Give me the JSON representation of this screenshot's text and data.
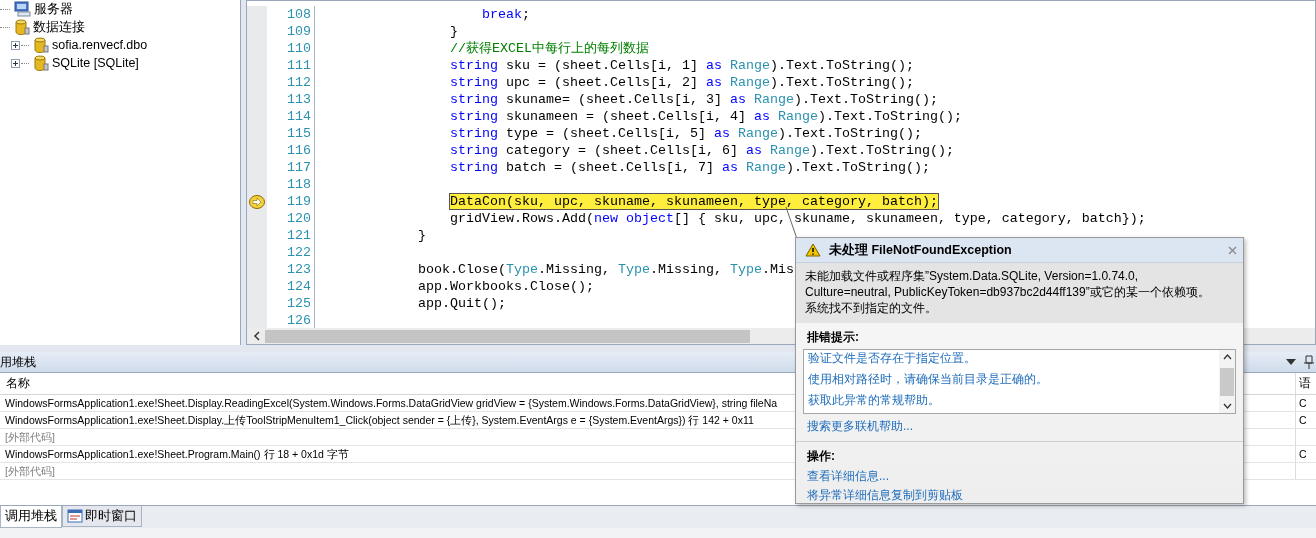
{
  "server_explorer": {
    "items": [
      {
        "label": "服务器",
        "kind": "server"
      },
      {
        "label": "数据连接",
        "kind": "database",
        "children": [
          {
            "label": "sofia.renvecf.dbo",
            "kind": "database",
            "expanded": false
          },
          {
            "label": "SQLite [SQLite]",
            "kind": "database",
            "expanded": false
          }
        ]
      }
    ]
  },
  "editor": {
    "lines": [
      {
        "no": "108",
        "tokens": [
          {
            "t": "                    break",
            "kind": "kw"
          },
          {
            "t": ";",
            "kind": "plain"
          }
        ]
      },
      {
        "no": "109",
        "tokens": [
          {
            "t": "                }",
            "kind": "plain"
          }
        ]
      },
      {
        "no": "110",
        "tokens": [
          {
            "t": "                //获得EXCEL中每行上的每列数据",
            "kind": "comment"
          }
        ]
      },
      {
        "no": "111",
        "tokens": [
          {
            "t": "                string",
            "kind": "kw"
          },
          {
            "t": " sku = (sheet.Cells[i, 1] ",
            "kind": "plain"
          },
          {
            "t": "as",
            "kind": "kw"
          },
          {
            "t": " Range",
            "kind": "type"
          },
          {
            "t": ").Text.ToString();",
            "kind": "plain"
          }
        ]
      },
      {
        "no": "112",
        "tokens": [
          {
            "t": "                string",
            "kind": "kw"
          },
          {
            "t": " upc = (sheet.Cells[i, 2] ",
            "kind": "plain"
          },
          {
            "t": "as",
            "kind": "kw"
          },
          {
            "t": " Range",
            "kind": "type"
          },
          {
            "t": ").Text.ToString();",
            "kind": "plain"
          }
        ]
      },
      {
        "no": "113",
        "tokens": [
          {
            "t": "                string",
            "kind": "kw"
          },
          {
            "t": " skuname= (sheet.Cells[i, 3] ",
            "kind": "plain"
          },
          {
            "t": "as",
            "kind": "kw"
          },
          {
            "t": " Range",
            "kind": "type"
          },
          {
            "t": ").Text.ToString();",
            "kind": "plain"
          }
        ]
      },
      {
        "no": "114",
        "tokens": [
          {
            "t": "                string",
            "kind": "kw"
          },
          {
            "t": " skunameen = (sheet.Cells[i, 4] ",
            "kind": "plain"
          },
          {
            "t": "as",
            "kind": "kw"
          },
          {
            "t": " Range",
            "kind": "type"
          },
          {
            "t": ").Text.ToString();",
            "kind": "plain"
          }
        ]
      },
      {
        "no": "115",
        "tokens": [
          {
            "t": "                string",
            "kind": "kw"
          },
          {
            "t": " type = (sheet.Cells[i, 5] ",
            "kind": "plain"
          },
          {
            "t": "as",
            "kind": "kw"
          },
          {
            "t": " Range",
            "kind": "type"
          },
          {
            "t": ").Text.ToString();",
            "kind": "plain"
          }
        ]
      },
      {
        "no": "116",
        "tokens": [
          {
            "t": "                string",
            "kind": "kw"
          },
          {
            "t": " category = (sheet.Cells[i, 6] ",
            "kind": "plain"
          },
          {
            "t": "as",
            "kind": "kw"
          },
          {
            "t": " Range",
            "kind": "type"
          },
          {
            "t": ").Text.ToString();",
            "kind": "plain"
          }
        ]
      },
      {
        "no": "117",
        "tokens": [
          {
            "t": "                string",
            "kind": "kw"
          },
          {
            "t": " batch = (sheet.Cells[i, 7] ",
            "kind": "plain"
          },
          {
            "t": "as",
            "kind": "kw"
          },
          {
            "t": " Range",
            "kind": "type"
          },
          {
            "t": ").Text.ToString();",
            "kind": "plain"
          }
        ]
      },
      {
        "no": "118"
      },
      {
        "no": "119",
        "current": true,
        "tokens": [
          {
            "t": "                DataCon(sku, upc, skuname, skunameen, type, category, batch);",
            "kind": "plain"
          }
        ]
      },
      {
        "no": "120",
        "tokens": [
          {
            "t": "                gridView.Rows.Add(",
            "kind": "plain"
          },
          {
            "t": "new object",
            "kind": "kw"
          },
          {
            "t": "[] { sku, upc, skuname, skunameen, type, category, batch});",
            "kind": "plain"
          }
        ]
      },
      {
        "no": "121",
        "tokens": [
          {
            "t": "            }",
            "kind": "plain"
          }
        ]
      },
      {
        "no": "122"
      },
      {
        "no": "123",
        "tokens": [
          {
            "t": "            book.Close(",
            "kind": "plain"
          },
          {
            "t": "Type",
            "kind": "type"
          },
          {
            "t": ".Missing, ",
            "kind": "plain"
          },
          {
            "t": "Type",
            "kind": "type"
          },
          {
            "t": ".Missing, ",
            "kind": "plain"
          },
          {
            "t": "Type",
            "kind": "type"
          },
          {
            "t": ".Mis",
            "kind": "plain"
          }
        ]
      },
      {
        "no": "124",
        "tokens": [
          {
            "t": "            app.Workbooks.Close();",
            "kind": "plain"
          }
        ]
      },
      {
        "no": "125",
        "tokens": [
          {
            "t": "            app.Quit();",
            "kind": "plain"
          }
        ]
      },
      {
        "no": "126"
      }
    ]
  },
  "exception_popup": {
    "title": "未处理 FileNotFoundException",
    "message": "未能加载文件或程序集”System.Data.SQLite, Version=1.0.74.0, Culture=neutral, PublicKeyToken=db937bc2d44ff139”或它的某一个依赖项。系统找不到指定的文件。",
    "tips_heading": "排错提示:",
    "tips": [
      "验证文件是否存在于指定位置。",
      "使用相对路径时，请确保当前目录是正确的。",
      "获取此异常的常规帮助。"
    ],
    "more_help": "搜索更多联机帮助...",
    "actions_heading": "操作:",
    "actions": [
      "查看详细信息...",
      "将异常详细信息复制到剪贴板"
    ]
  },
  "call_stack": {
    "title": "用堆栈",
    "columns": [
      "名称",
      "语"
    ],
    "rows": [
      {
        "name": "WindowsFormsApplication1.exe!Sheet.Display.ReadingExcel(System.Windows.Forms.DataGridView gridView = {System.Windows.Forms.DataGridView}, string fileNa",
        "language": "C",
        "external": false
      },
      {
        "name": "WindowsFormsApplication1.exe!Sheet.Display.上传ToolStripMenuItem1_Click(object sender = {上传}, System.EventArgs e = {System.EventArgs}) 行 142 + 0x11",
        "language": "C",
        "external": false
      },
      {
        "name": "[外部代码]",
        "external": true
      },
      {
        "name": "WindowsFormsApplication1.exe!Sheet.Program.Main() 行 18 + 0x1d 字节",
        "language": "C",
        "external": false
      },
      {
        "name": "[外部代码]",
        "external": true
      }
    ]
  },
  "bottom_tabs": [
    {
      "label": "调用堆栈",
      "selected": true
    },
    {
      "label": "即时窗口",
      "selected": false
    }
  ]
}
